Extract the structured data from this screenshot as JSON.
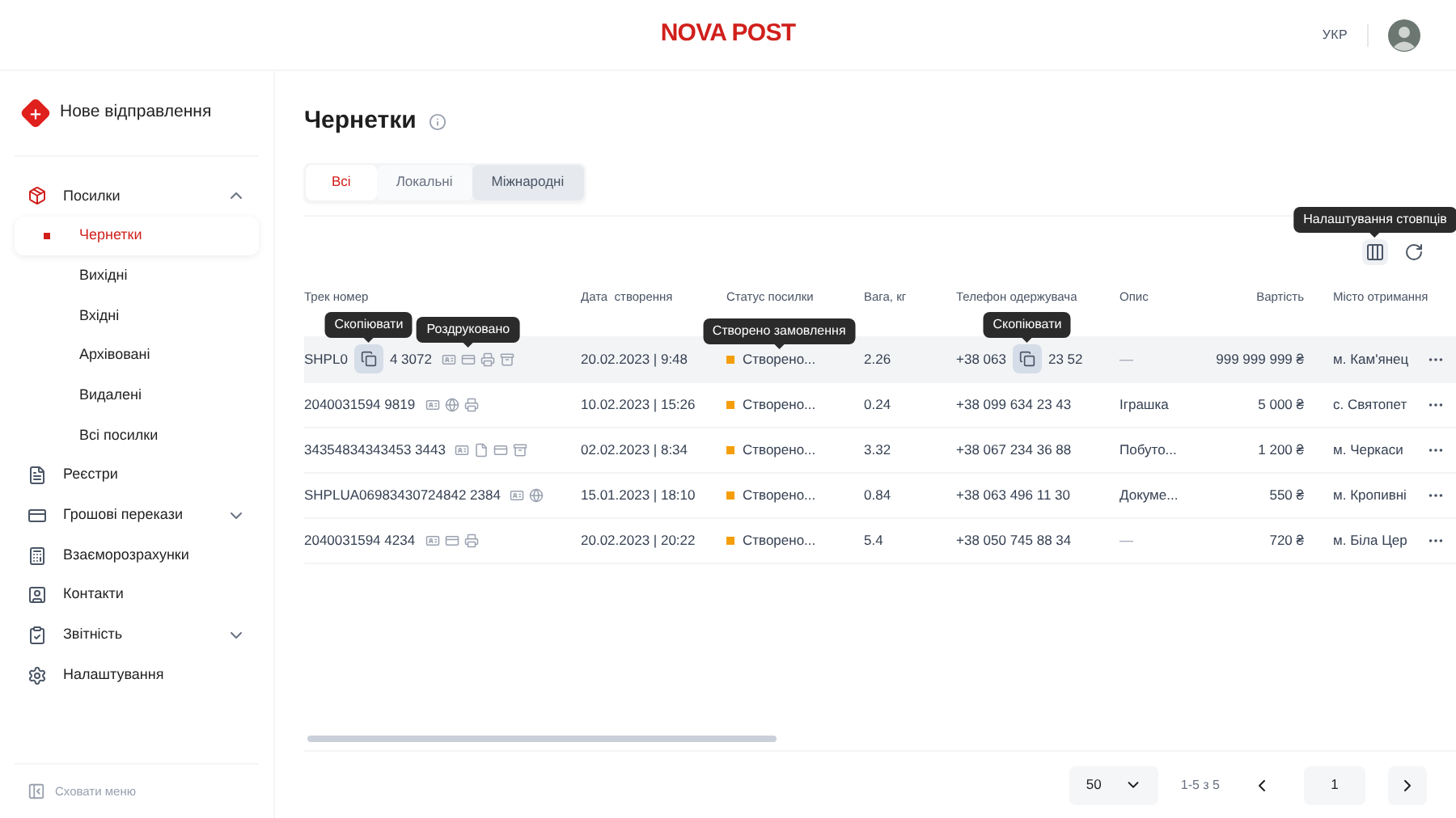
{
  "header": {
    "logo": "NOVA POST",
    "language": "УКР"
  },
  "sidebar": {
    "new_button": "Нове відправлення",
    "items": [
      {
        "label": "Посилки",
        "expanded": true,
        "children": [
          {
            "label": "Чернетки",
            "selected": true
          },
          {
            "label": "Вихідні",
            "selected": false
          },
          {
            "label": "Вхідні",
            "selected": false
          },
          {
            "label": "Архівовані",
            "selected": false
          },
          {
            "label": "Видалені",
            "selected": false
          },
          {
            "label": "Всі посилки",
            "selected": false
          }
        ]
      },
      {
        "label": "Реєстри"
      },
      {
        "label": "Грошові перекази",
        "expanded": false
      },
      {
        "label": "Взаєморозрахунки"
      },
      {
        "label": "Контакти"
      },
      {
        "label": "Звітність",
        "expanded": false
      },
      {
        "label": "Налаштування"
      }
    ],
    "collapse": "Сховати меню"
  },
  "page": {
    "title": "Чернетки"
  },
  "tabs": [
    {
      "label": "Всі",
      "selected": true
    },
    {
      "label": "Локальні",
      "selected": false
    },
    {
      "label": "Міжнародні",
      "selected": false
    }
  ],
  "column_settings_tooltip": "Налаштування стовпців",
  "table": {
    "columns": [
      "Трек номер",
      "Дата  створення",
      "Статус посилки",
      "Вага, кг",
      "Телефон одержувача",
      "Опис",
      "Вартість",
      "Місто отримання"
    ],
    "rows": [
      {
        "track": [
          "SHPL0",
          "4 3072"
        ],
        "track_tooltip": "Скопіювати",
        "icons": [
          {
            "kind": "photo"
          },
          {
            "kind": "invoice"
          },
          {
            "kind": "print"
          },
          {
            "kind": "box"
          }
        ],
        "icon_tooltip": "Роздруковано",
        "date": "20.02.2023 | 9:48",
        "status": "Створено...",
        "color": "#f59e0b",
        "status_tooltip": "Створено замовлення",
        "weight": "2.26",
        "phone": [
          "+38 063",
          "23 52"
        ],
        "phone_tooltip": "Скопіювати",
        "description": "—",
        "cost": "999 999 999 ₴",
        "city": "м. Кам'янец"
      },
      {
        "track": [
          "2040031594 9819"
        ],
        "icons": [
          {
            "kind": "photo"
          },
          {
            "kind": "globe"
          },
          {
            "kind": "print"
          }
        ],
        "date": "10.02.2023 | 15:26",
        "status": "Створено...",
        "color": "#f59e0b",
        "weight": "0.24",
        "phone": [
          "+38 099 634 23 43"
        ],
        "description": "Іграшка",
        "cost": "5 000 ₴",
        "city": "с. Святопет"
      },
      {
        "track": [
          "34354834343453 3443"
        ],
        "icons": [
          {
            "kind": "photo"
          },
          {
            "kind": "doc"
          },
          {
            "kind": "invoice"
          },
          {
            "kind": "box"
          }
        ],
        "date": "02.02.2023 | 8:34",
        "status": "Створено...",
        "color": "#f59e0b",
        "weight": "3.32",
        "phone": [
          "+38 067 234 36 88"
        ],
        "description": "Побуто...",
        "cost": "1 200 ₴",
        "city": "м. Черкаси"
      },
      {
        "track": [
          "SHPLUA06983430724842 2384"
        ],
        "icons": [
          {
            "kind": "photo"
          },
          {
            "kind": "globe"
          }
        ],
        "date": "15.01.2023 | 18:10",
        "status": "Створено...",
        "color": "#f59e0b",
        "weight": "0.84",
        "phone": [
          "+38 063 496 11 30"
        ],
        "description": "Докуме...",
        "cost": "550 ₴",
        "city": "м. Кропивні"
      },
      {
        "track": [
          "2040031594 4234"
        ],
        "icons": [
          {
            "kind": "photo"
          },
          {
            "kind": "invoice"
          },
          {
            "kind": "print"
          }
        ],
        "date": "20.02.2023 | 20:22",
        "status": "Створено...",
        "color": "#f59e0b",
        "weight": "5.4",
        "phone": [
          "+38 050 745 88 34"
        ],
        "description": "—",
        "cost": "720 ₴",
        "city": "м. Біла Цер"
      }
    ]
  },
  "pagination": {
    "page_size": "50",
    "range": "1-5 з 5",
    "page": "1"
  }
}
